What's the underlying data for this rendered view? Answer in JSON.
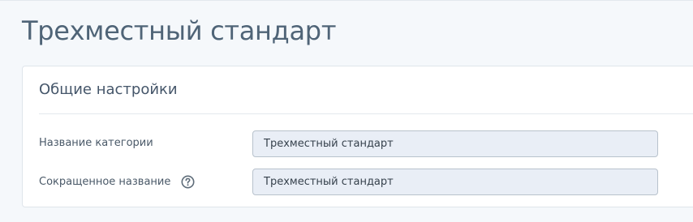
{
  "page": {
    "title": "Трехместный стандарт"
  },
  "panel": {
    "header": "Общие настройки",
    "fields": [
      {
        "label": "Название категории",
        "value": "Трехместный стандарт",
        "help_icon": false
      },
      {
        "label": "Сокращенное название",
        "value": "Трехместный стандарт",
        "help_icon": true,
        "icon": "question-circle-icon"
      }
    ]
  },
  "colors": {
    "background": "#f5f8fb",
    "panel": "#ffffff",
    "input_bg": "#e9eef6",
    "input_border": "#b8c2cc",
    "title": "#4f6477"
  }
}
